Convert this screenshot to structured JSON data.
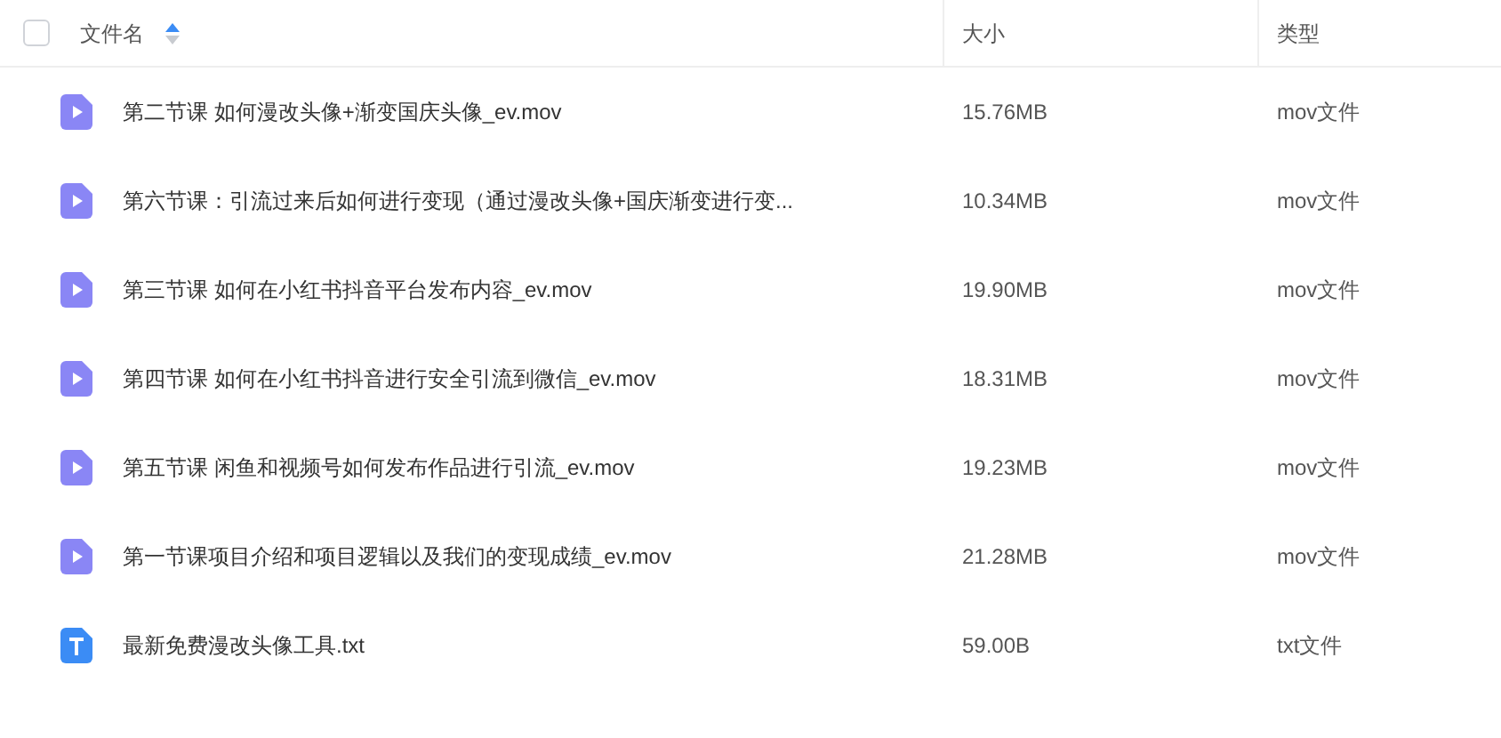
{
  "header": {
    "select_all": {
      "checked": false
    },
    "columns": [
      {
        "label": "文件名",
        "sorted": true
      },
      {
        "label": "大小"
      },
      {
        "label": "类型"
      }
    ]
  },
  "rows": [
    {
      "kind": "video",
      "name": "第二节课 如何漫改头像+渐变国庆头像_ev.mov",
      "size": "15.76MB",
      "type": "mov文件"
    },
    {
      "kind": "video",
      "name": "第六节课：引流过来后如何进行变现（通过漫改头像+国庆渐变进行变...",
      "size": "10.34MB",
      "type": "mov文件"
    },
    {
      "kind": "video",
      "name": "第三节课 如何在小红书抖音平台发布内容_ev.mov",
      "size": "19.90MB",
      "type": "mov文件"
    },
    {
      "kind": "video",
      "name": "第四节课 如何在小红书抖音进行安全引流到微信_ev.mov",
      "size": "18.31MB",
      "type": "mov文件"
    },
    {
      "kind": "video",
      "name": "第五节课 闲鱼和视频号如何发布作品进行引流_ev.mov",
      "size": "19.23MB",
      "type": "mov文件"
    },
    {
      "kind": "video",
      "name": "第一节课项目介绍和项目逻辑以及我们的变现成绩_ev.mov",
      "size": "21.28MB",
      "type": "mov文件"
    },
    {
      "kind": "text",
      "name": "最新免费漫改头像工具.txt",
      "size": "59.00B",
      "type": "txt文件"
    }
  ]
}
